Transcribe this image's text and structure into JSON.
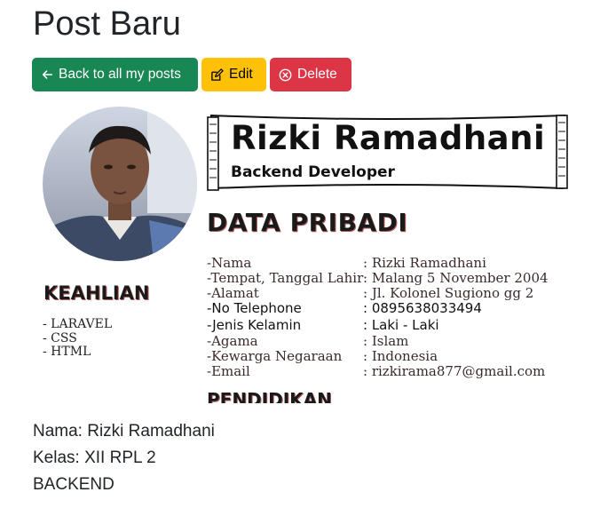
{
  "page": {
    "title": "Post Baru"
  },
  "buttons": {
    "back_label": "Back to all my posts",
    "edit_label": "Edit",
    "delete_label": "Delete"
  },
  "cv": {
    "name": "Rizki Ramadhani",
    "role": "Backend Developer",
    "data_heading": "DATA PRIBADI",
    "skills_heading": "KEAHLIAN",
    "skills": [
      "- LARAVEL",
      "- CSS",
      "- HTML"
    ],
    "education_heading": "PENDIDIKAN",
    "personal": [
      {
        "label": "-Nama",
        "value": ": Rizki Ramadhani"
      },
      {
        "label": "-Tempat, Tanggal Lahir",
        "value": ": Malang 5 November 2004"
      },
      {
        "label": "-Alamat",
        "value": ": Jl. Kolonel Sugiono gg 2"
      },
      {
        "label": "-No Telephone",
        "value": ": 0895638033494"
      },
      {
        "label": "-Jenis Kelamin",
        "value": ": Laki - Laki"
      },
      {
        "label": "-Agama",
        "value": ": Islam"
      },
      {
        "label": "-Kewarga Negaraan",
        "value": ": Indonesia"
      },
      {
        "label": "-Email",
        "value": ": rizkirama877@gmail.com"
      }
    ]
  },
  "info": {
    "nama": "Nama: Rizki Ramadhani",
    "kelas": "Kelas: XII RPL 2",
    "jurusan": "BACKEND"
  },
  "colors": {
    "success": "#198754",
    "warning": "#ffc107",
    "danger": "#dc3545",
    "text": "#212529"
  }
}
